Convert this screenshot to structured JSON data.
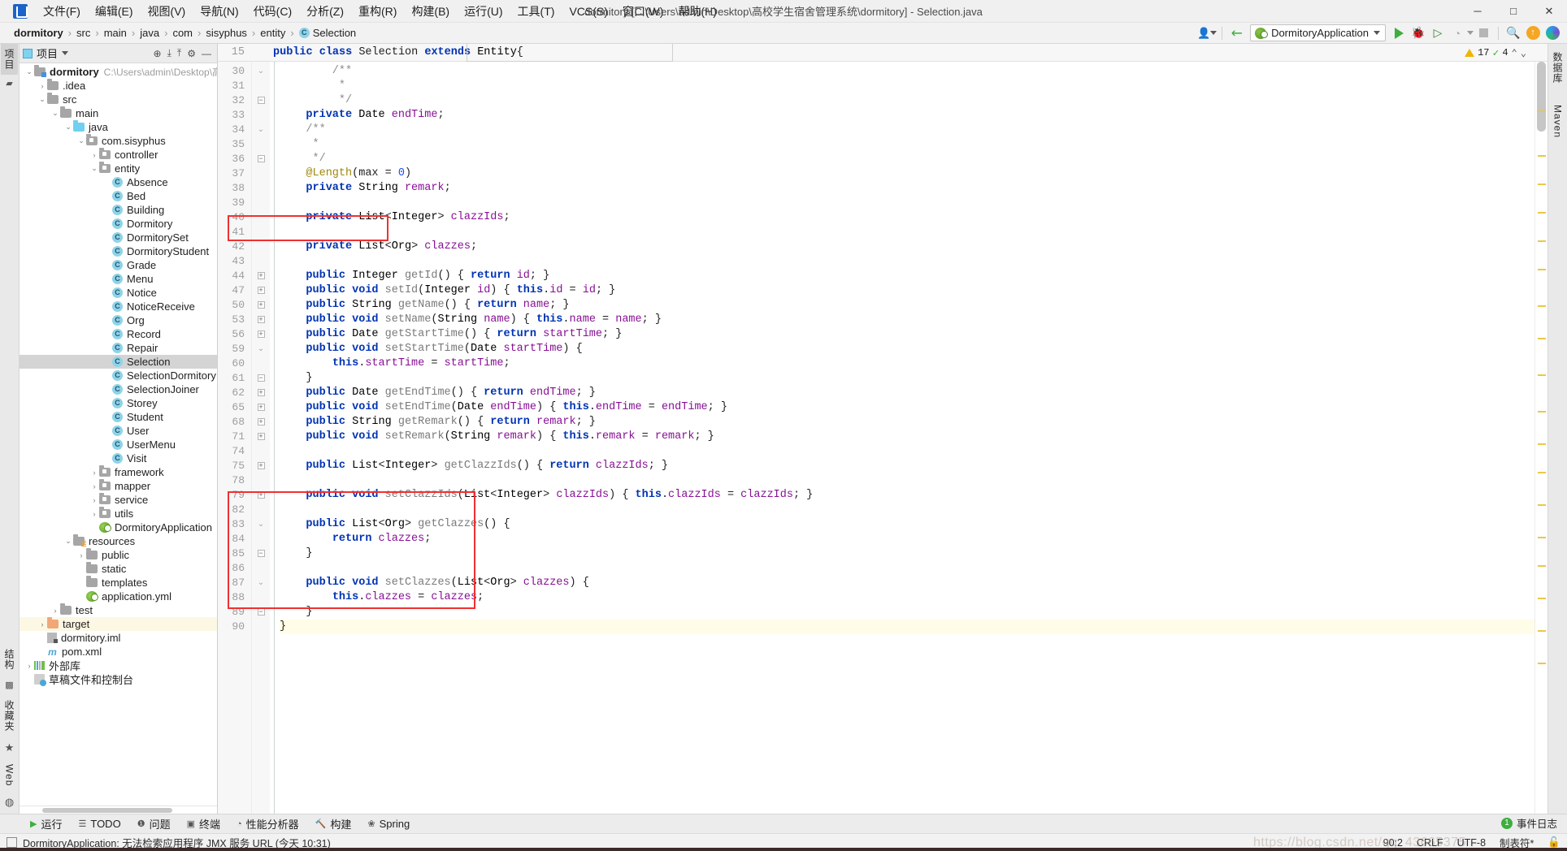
{
  "window": {
    "title": "dormitory [C:\\Users\\admin\\Desktop\\高校学生宿舍管理系统\\dormitory] - Selection.java",
    "minimize": "─",
    "maximize": "□",
    "close": "✕"
  },
  "menu": [
    {
      "label": "文件(F)"
    },
    {
      "label": "编辑(E)"
    },
    {
      "label": "视图(V)"
    },
    {
      "label": "导航(N)"
    },
    {
      "label": "代码(C)"
    },
    {
      "label": "分析(Z)"
    },
    {
      "label": "重构(R)"
    },
    {
      "label": "构建(B)"
    },
    {
      "label": "运行(U)"
    },
    {
      "label": "工具(T)"
    },
    {
      "label": "VCS(S)"
    },
    {
      "label": "窗口(W)"
    },
    {
      "label": "帮助(H)"
    }
  ],
  "breadcrumbs": [
    {
      "label": "dormitory",
      "bold": true
    },
    {
      "label": "src"
    },
    {
      "label": "main"
    },
    {
      "label": "java"
    },
    {
      "label": "com"
    },
    {
      "label": "sisyphus"
    },
    {
      "label": "entity"
    },
    {
      "label": "Selection",
      "icon": "C"
    }
  ],
  "toolbar": {
    "run_config": "DormitoryApplication",
    "run_label": "▶",
    "debug_label": "🐞",
    "coverage_label": "▶",
    "profile_label": "◔",
    "stop_label": "■",
    "search_label": "🔍",
    "update_label": "↑",
    "ide_label": "◑",
    "user_icon": "👤"
  },
  "project_panel": {
    "title": "项目",
    "tree": [
      {
        "indent": 0,
        "arrow": "v",
        "icon": "folder-module",
        "label": "dormitory",
        "bold": true,
        "path": "C:\\Users\\admin\\Desktop\\高校学"
      },
      {
        "indent": 1,
        "arrow": ">",
        "icon": "folder",
        "label": ".idea"
      },
      {
        "indent": 1,
        "arrow": "v",
        "icon": "folder",
        "label": "src"
      },
      {
        "indent": 2,
        "arrow": "v",
        "icon": "folder",
        "label": "main"
      },
      {
        "indent": 3,
        "arrow": "v",
        "icon": "folder-blue",
        "label": "java"
      },
      {
        "indent": 4,
        "arrow": "v",
        "icon": "folder-pkg",
        "label": "com.sisyphus"
      },
      {
        "indent": 5,
        "arrow": ">",
        "icon": "folder-pkg",
        "label": "controller"
      },
      {
        "indent": 5,
        "arrow": "v",
        "icon": "folder-pkg",
        "label": "entity"
      },
      {
        "indent": 6,
        "arrow": "",
        "icon": "class",
        "label": "Absence"
      },
      {
        "indent": 6,
        "arrow": "",
        "icon": "class",
        "label": "Bed"
      },
      {
        "indent": 6,
        "arrow": "",
        "icon": "class",
        "label": "Building"
      },
      {
        "indent": 6,
        "arrow": "",
        "icon": "class",
        "label": "Dormitory"
      },
      {
        "indent": 6,
        "arrow": "",
        "icon": "class",
        "label": "DormitorySet"
      },
      {
        "indent": 6,
        "arrow": "",
        "icon": "class",
        "label": "DormitoryStudent"
      },
      {
        "indent": 6,
        "arrow": "",
        "icon": "class",
        "label": "Grade"
      },
      {
        "indent": 6,
        "arrow": "",
        "icon": "class",
        "label": "Menu"
      },
      {
        "indent": 6,
        "arrow": "",
        "icon": "class",
        "label": "Notice"
      },
      {
        "indent": 6,
        "arrow": "",
        "icon": "class",
        "label": "NoticeReceive"
      },
      {
        "indent": 6,
        "arrow": "",
        "icon": "class",
        "label": "Org"
      },
      {
        "indent": 6,
        "arrow": "",
        "icon": "class",
        "label": "Record"
      },
      {
        "indent": 6,
        "arrow": "",
        "icon": "class",
        "label": "Repair"
      },
      {
        "indent": 6,
        "arrow": "",
        "icon": "class",
        "label": "Selection",
        "selected": true
      },
      {
        "indent": 6,
        "arrow": "",
        "icon": "class",
        "label": "SelectionDormitory"
      },
      {
        "indent": 6,
        "arrow": "",
        "icon": "class",
        "label": "SelectionJoiner"
      },
      {
        "indent": 6,
        "arrow": "",
        "icon": "class",
        "label": "Storey"
      },
      {
        "indent": 6,
        "arrow": "",
        "icon": "class",
        "label": "Student"
      },
      {
        "indent": 6,
        "arrow": "",
        "icon": "class",
        "label": "User"
      },
      {
        "indent": 6,
        "arrow": "",
        "icon": "class",
        "label": "UserMenu"
      },
      {
        "indent": 6,
        "arrow": "",
        "icon": "class",
        "label": "Visit"
      },
      {
        "indent": 5,
        "arrow": ">",
        "icon": "folder-pkg",
        "label": "framework"
      },
      {
        "indent": 5,
        "arrow": ">",
        "icon": "folder-pkg",
        "label": "mapper"
      },
      {
        "indent": 5,
        "arrow": ">",
        "icon": "folder-pkg",
        "label": "service"
      },
      {
        "indent": 5,
        "arrow": ">",
        "icon": "folder-pkg",
        "label": "utils"
      },
      {
        "indent": 5,
        "arrow": "",
        "icon": "spring",
        "label": "DormitoryApplication"
      },
      {
        "indent": 3,
        "arrow": "v",
        "icon": "folder-res",
        "label": "resources"
      },
      {
        "indent": 4,
        "arrow": ">",
        "icon": "folder",
        "label": "public"
      },
      {
        "indent": 4,
        "arrow": "",
        "icon": "folder",
        "label": "static"
      },
      {
        "indent": 4,
        "arrow": "",
        "icon": "folder",
        "label": "templates"
      },
      {
        "indent": 4,
        "arrow": "",
        "icon": "spring",
        "label": "application.yml"
      },
      {
        "indent": 2,
        "arrow": ">",
        "icon": "folder",
        "label": "test"
      },
      {
        "indent": 1,
        "arrow": ">",
        "icon": "folder-orange",
        "label": "target",
        "highlight": true
      },
      {
        "indent": 1,
        "arrow": "",
        "icon": "iml",
        "label": "dormitory.iml"
      },
      {
        "indent": 1,
        "arrow": "",
        "icon": "maven",
        "label": "pom.xml"
      },
      {
        "indent": 0,
        "arrow": ">",
        "icon": "library",
        "label": "外部库"
      },
      {
        "indent": 0,
        "arrow": "",
        "icon": "scratch",
        "label": "草稿文件和控制台"
      }
    ]
  },
  "left_strip": [
    {
      "label": "项目",
      "active": true
    },
    {
      "label": "结构"
    },
    {
      "label": "收藏夹"
    },
    {
      "label": "Web"
    }
  ],
  "right_strip": [
    {
      "label": "数据库"
    },
    {
      "label": "Maven"
    }
  ],
  "editor": {
    "sticky_line": "public class Selection extends Entity{",
    "sticky_line_number": "15",
    "inspection": {
      "warnings": "17",
      "checks": "4"
    },
    "lines": [
      {
        "n": "30",
        "fold": "v",
        "text": "        /**"
      },
      {
        "n": "31",
        "fold": "",
        "text": "         *"
      },
      {
        "n": "32",
        "fold": "-",
        "text": "         */"
      },
      {
        "n": "33",
        "fold": "",
        "text": "    private Date endTime;"
      },
      {
        "n": "34",
        "fold": "v",
        "text": "    /**"
      },
      {
        "n": "35",
        "fold": "",
        "text": "     *"
      },
      {
        "n": "36",
        "fold": "-",
        "text": "     */"
      },
      {
        "n": "37",
        "fold": "",
        "text": "    @Length(max = 0)"
      },
      {
        "n": "38",
        "fold": "",
        "text": "    private String remark;"
      },
      {
        "n": "39",
        "fold": "",
        "text": ""
      },
      {
        "n": "40",
        "fold": "",
        "text": "    private List<Integer> clazzIds;"
      },
      {
        "n": "41",
        "fold": "",
        "text": ""
      },
      {
        "n": "42",
        "fold": "",
        "text": "    private List<Org> clazzes;"
      },
      {
        "n": "43",
        "fold": "",
        "text": ""
      },
      {
        "n": "44",
        "fold": "+",
        "text": "    public Integer getId() { return id; }"
      },
      {
        "n": "47",
        "fold": "+",
        "text": "    public void setId(Integer id) { this.id = id; }"
      },
      {
        "n": "50",
        "fold": "+",
        "text": "    public String getName() { return name; }"
      },
      {
        "n": "53",
        "fold": "+",
        "text": "    public void setName(String name) { this.name = name; }"
      },
      {
        "n": "56",
        "fold": "+",
        "text": "    public Date getStartTime() { return startTime; }"
      },
      {
        "n": "59",
        "fold": "v",
        "text": "    public void setStartTime(Date startTime) {"
      },
      {
        "n": "60",
        "fold": "",
        "text": "        this.startTime = startTime;"
      },
      {
        "n": "61",
        "fold": "-",
        "text": "    }"
      },
      {
        "n": "62",
        "fold": "+",
        "text": "    public Date getEndTime() { return endTime; }"
      },
      {
        "n": "65",
        "fold": "+",
        "text": "    public void setEndTime(Date endTime) { this.endTime = endTime; }"
      },
      {
        "n": "68",
        "fold": "+",
        "text": "    public String getRemark() { return remark; }"
      },
      {
        "n": "71",
        "fold": "+",
        "text": "    public void setRemark(String remark) { this.remark = remark; }"
      },
      {
        "n": "74",
        "fold": "",
        "text": ""
      },
      {
        "n": "75",
        "fold": "+",
        "text": "    public List<Integer> getClazzIds() { return clazzIds; }"
      },
      {
        "n": "78",
        "fold": "",
        "text": ""
      },
      {
        "n": "79",
        "fold": "+",
        "text": "    public void setClazzIds(List<Integer> clazzIds) { this.clazzIds = clazzIds; }"
      },
      {
        "n": "82",
        "fold": "",
        "text": ""
      },
      {
        "n": "83",
        "fold": "v",
        "text": "    public List<Org> getClazzes() {"
      },
      {
        "n": "84",
        "fold": "",
        "text": "        return clazzes;"
      },
      {
        "n": "85",
        "fold": "-",
        "text": "    }"
      },
      {
        "n": "86",
        "fold": "",
        "text": ""
      },
      {
        "n": "87",
        "fold": "v",
        "text": "    public void setClazzes(List<Org> clazzes) {"
      },
      {
        "n": "88",
        "fold": "",
        "text": "        this.clazzes = clazzes;"
      },
      {
        "n": "89",
        "fold": "-",
        "text": "    }"
      },
      {
        "n": "90",
        "fold": "",
        "text": "}",
        "current": true
      }
    ]
  },
  "bottom_bar": [
    {
      "label": "运行",
      "icon": "run-icon"
    },
    {
      "label": "TODO",
      "icon": "todo-icon"
    },
    {
      "label": "问题",
      "icon": "problems-icon"
    },
    {
      "label": "终端",
      "icon": "terminal-icon"
    },
    {
      "label": "性能分析器",
      "icon": "profiler-icon"
    },
    {
      "label": "构建",
      "icon": "build-icon"
    },
    {
      "label": "Spring",
      "icon": "spring-icon"
    }
  ],
  "status_bar": {
    "message": "DormitoryApplication: 无法检索应用程序 JMX 服务 URL (今天 10:31)",
    "position": "90:2",
    "line_separator": "CRLF",
    "encoding": "UTF-8",
    "indent": "制表符*",
    "event_log": "事件日志",
    "event_count": "1",
    "watermark": "https://blog.csdn.net/qq_43665375"
  },
  "colors": {
    "accent_blue": "#0033b3",
    "field_purple": "#871094",
    "annotation": "#9e880d",
    "highlight_red": "#f03030",
    "selected_row": "#d4d4d4",
    "target_highlight": "#fcf8e3"
  }
}
